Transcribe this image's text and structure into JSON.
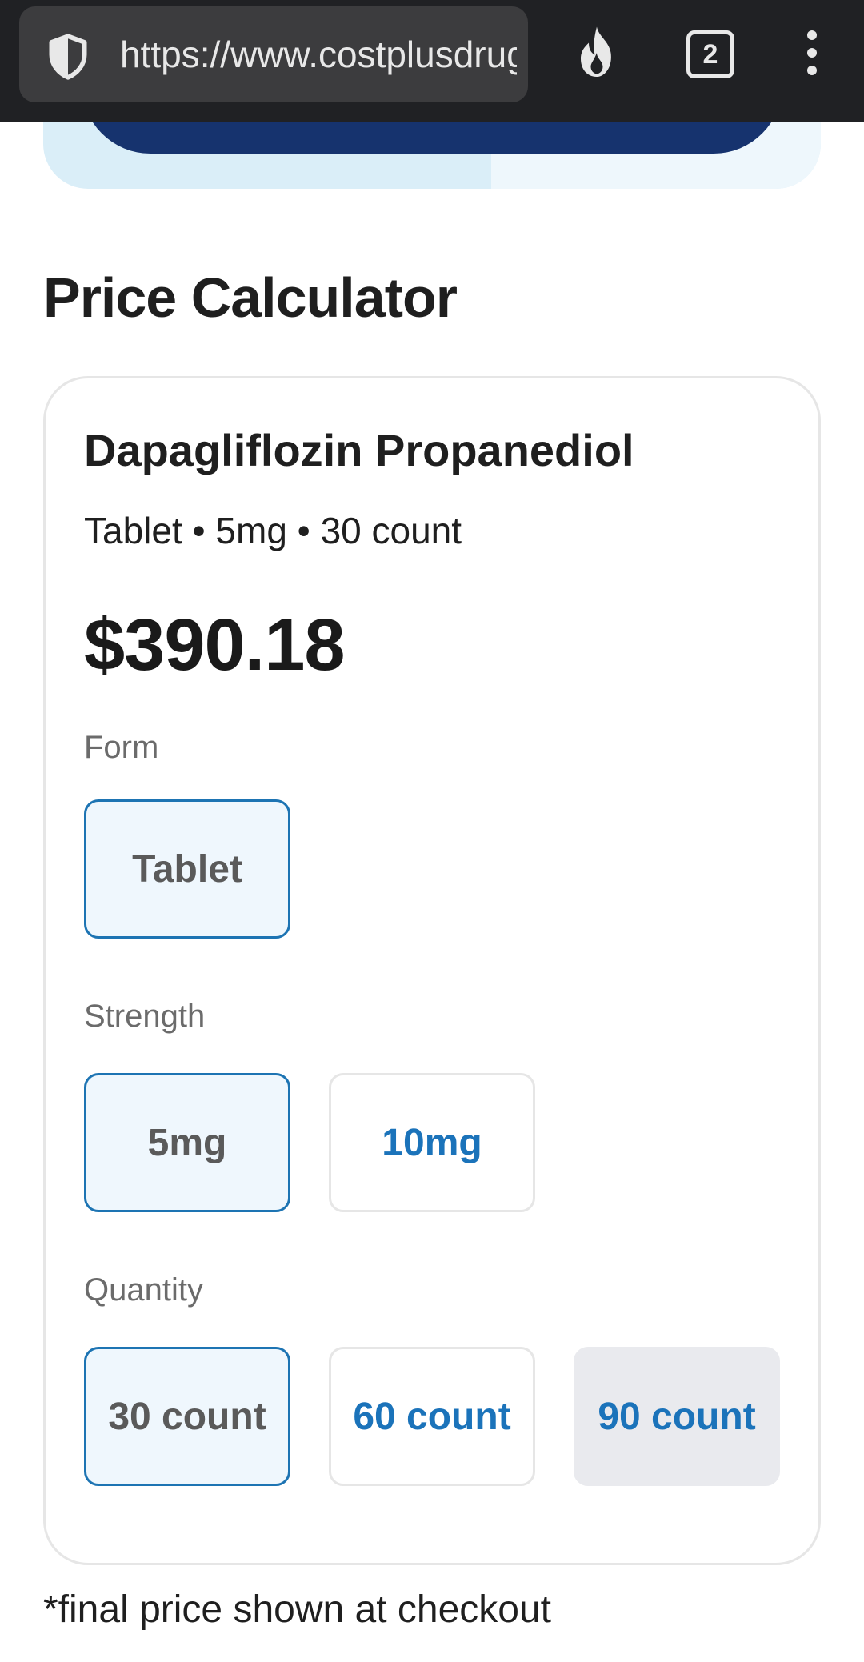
{
  "browser": {
    "url": "https://www.costplusdrugs.com",
    "tab_count": "2",
    "icons": [
      "shield-icon",
      "fire-icon",
      "tabs-icon",
      "more-menu-icon"
    ]
  },
  "calculator": {
    "heading": "Price Calculator",
    "drug_name": "Dapagliflozin Propanediol",
    "summary": "Tablet • 5mg • 30 count",
    "price": "$390.18",
    "form": {
      "label": "Form",
      "options": [
        {
          "label": "Tablet",
          "selected": true
        }
      ]
    },
    "strength": {
      "label": "Strength",
      "options": [
        {
          "label": "5mg",
          "selected": true
        },
        {
          "label": "10mg",
          "selected": false
        }
      ]
    },
    "quantity": {
      "label": "Quantity",
      "options": [
        {
          "label": "30 count",
          "selected": true
        },
        {
          "label": "60 count",
          "selected": false
        },
        {
          "label": "90 count",
          "selected": false
        }
      ]
    },
    "footnote": "*final price shown at checkout"
  },
  "colors": {
    "accent": "#1d74b3",
    "navy": "#16336e",
    "selected_bg": "#eff7fd",
    "toolbar": "#202124"
  }
}
